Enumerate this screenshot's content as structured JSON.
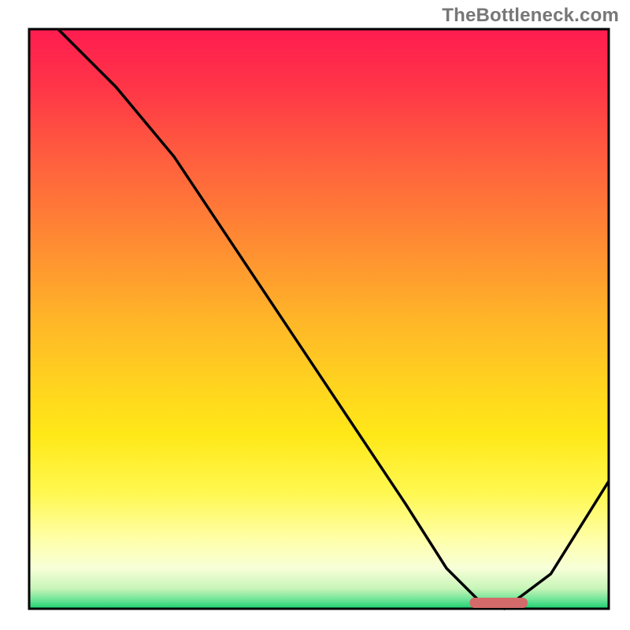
{
  "watermark": "TheBottleneck.com",
  "colors": {
    "border": "#000000",
    "curve": "#000000",
    "marker": "#d46a6a",
    "gradient_stops": [
      {
        "offset": 0.0,
        "color": "#ff1c50"
      },
      {
        "offset": 0.1,
        "color": "#ff3547"
      },
      {
        "offset": 0.2,
        "color": "#ff5740"
      },
      {
        "offset": 0.3,
        "color": "#ff7638"
      },
      {
        "offset": 0.4,
        "color": "#ff9530"
      },
      {
        "offset": 0.5,
        "color": "#ffb528"
      },
      {
        "offset": 0.6,
        "color": "#ffd020"
      },
      {
        "offset": 0.7,
        "color": "#ffe818"
      },
      {
        "offset": 0.8,
        "color": "#fff850"
      },
      {
        "offset": 0.88,
        "color": "#ffffa8"
      },
      {
        "offset": 0.93,
        "color": "#f7ffd8"
      },
      {
        "offset": 0.965,
        "color": "#c8f5b8"
      },
      {
        "offset": 0.985,
        "color": "#6be396"
      },
      {
        "offset": 1.0,
        "color": "#18d070"
      }
    ]
  },
  "chart_data": {
    "type": "line",
    "title": "",
    "xlabel": "",
    "ylabel": "",
    "xlim": [
      0,
      100
    ],
    "ylim": [
      0,
      100
    ],
    "x": [
      5,
      15,
      25,
      35,
      45,
      55,
      65,
      72,
      78,
      82,
      90,
      100
    ],
    "values": [
      100,
      90,
      78,
      63,
      48,
      33,
      18,
      7,
      1,
      0,
      6,
      22
    ],
    "optimal_range_x": [
      76,
      86
    ],
    "note": "y-axis inverted in rendering: 0 at bottom (green/good), 100 at top (red/bad). Curve shows bottleneck severity; minimum ≈ x=80 marked by red pill."
  }
}
